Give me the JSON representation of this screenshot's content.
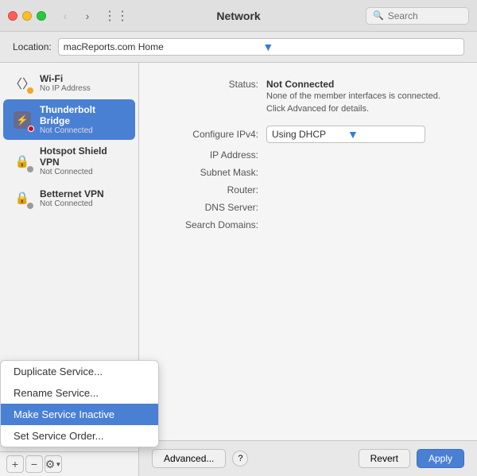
{
  "titleBar": {
    "title": "Network",
    "searchPlaceholder": "Search"
  },
  "locationBar": {
    "label": "Location:",
    "value": "macReports.com Home"
  },
  "sidebar": {
    "items": [
      {
        "id": "wifi",
        "name": "Wi-Fi",
        "status": "No IP Address",
        "iconType": "wifi",
        "dotColor": "yellow",
        "selected": false
      },
      {
        "id": "thunderbolt",
        "name": "Thunderbolt Bridge",
        "status": "Not Connected",
        "iconType": "thunderbolt",
        "dotColor": "red",
        "selected": true
      },
      {
        "id": "hotspot",
        "name": "Hotspot Shield VPN",
        "status": "Not Connected",
        "iconType": "lock",
        "dotColor": "gray",
        "selected": false
      },
      {
        "id": "betternet",
        "name": "Betternet VPN",
        "status": "Not Connected",
        "iconType": "lock",
        "dotColor": "gray",
        "selected": false
      }
    ],
    "toolbar": {
      "addLabel": "+",
      "removeLabel": "−",
      "gearLabel": "⚙"
    }
  },
  "detail": {
    "statusLabel": "Status:",
    "statusValue": "Not Connected",
    "statusSubtext": "None of the member interfaces is connected.\nClick Advanced for details.",
    "configIPv4Label": "Configure IPv4:",
    "configIPv4Value": "Using DHCP",
    "ipAddressLabel": "IP Address:",
    "ipAddressValue": "",
    "subnetMaskLabel": "Subnet Mask:",
    "subnetMaskValue": "",
    "routerLabel": "Router:",
    "routerValue": "",
    "dnsServerLabel": "DNS Server:",
    "dnsServerValue": "",
    "searchDomainsLabel": "Search Domains:",
    "searchDomainsValue": ""
  },
  "actions": {
    "advancedLabel": "Advanced...",
    "helpLabel": "?",
    "revertLabel": "Revert",
    "applyLabel": "Apply"
  },
  "dropdownMenu": {
    "items": [
      {
        "id": "duplicate",
        "label": "Duplicate Service...",
        "highlighted": false
      },
      {
        "id": "rename",
        "label": "Rename Service...",
        "highlighted": false
      },
      {
        "id": "make-inactive",
        "label": "Make Service Inactive",
        "highlighted": true
      },
      {
        "id": "set-order",
        "label": "Set Service Order...",
        "highlighted": false
      }
    ]
  }
}
